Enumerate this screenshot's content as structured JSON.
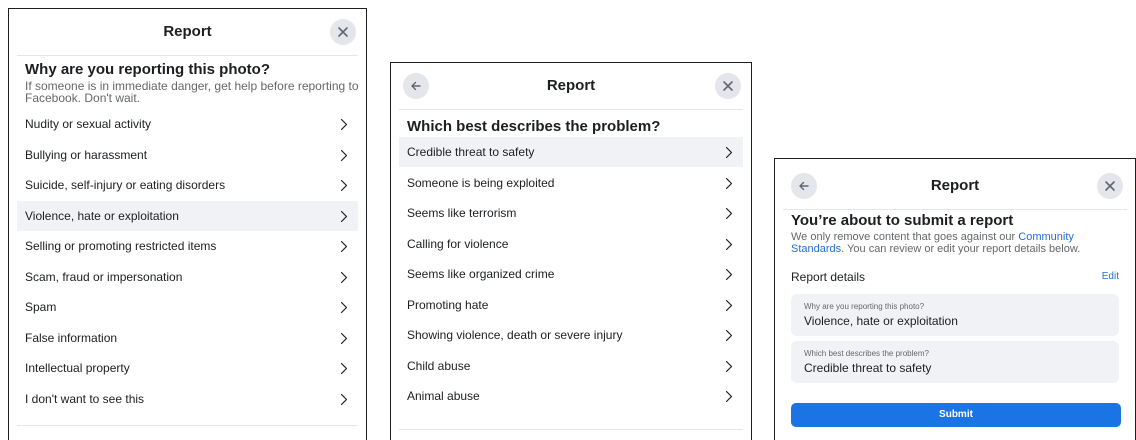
{
  "panel1": {
    "title": "Report",
    "heading": "Why are you reporting this photo?",
    "subtext_line1": "If someone is in immediate danger, get help before reporting to",
    "subtext_line2": "Facebook. Don't wait.",
    "options": [
      "Nudity or sexual activity",
      "Bullying or harassment",
      "Suicide, self-injury or eating disorders",
      "Violence, hate or exploitation",
      "Selling or promoting restricted items",
      "Scam, fraud or impersonation",
      "Spam",
      "False information",
      "Intellectual property",
      "I don't want to see this"
    ],
    "selected_option": "Violence, hate or exploitation"
  },
  "panel2": {
    "title": "Report",
    "heading": "Which best describes the problem?",
    "options": [
      "Credible threat to safety",
      "Someone is being exploited",
      "Seems like terrorism",
      "Calling for violence",
      "Seems like organized crime",
      "Promoting hate",
      "Showing violence, death or severe injury",
      "Child abuse",
      "Animal abuse"
    ],
    "selected_option": "Credible threat to safety"
  },
  "panel3": {
    "title": "Report",
    "heading": "You’re about to submit a report",
    "line1_text": "We only remove content that goes against our ",
    "line1_link": "Community",
    "line2_link": "Standards",
    "line2_text": ". You can review or edit your report details below.",
    "details_label": "Report details",
    "edit_label": "Edit",
    "q1": "Why are you reporting this photo?",
    "a1": "Violence, hate or exploitation",
    "q2": "Which best describes the problem?",
    "a2": "Credible threat to safety",
    "submit_label": "Submit"
  },
  "icons": {
    "close": "close-icon",
    "back": "back-arrow-icon",
    "chevron": "chevron-right-icon"
  },
  "colors": {
    "accent": "#1b74e4",
    "link": "#216fdb",
    "selected_row": "#f0f2f5",
    "icon_bg": "#e4e6eb"
  }
}
